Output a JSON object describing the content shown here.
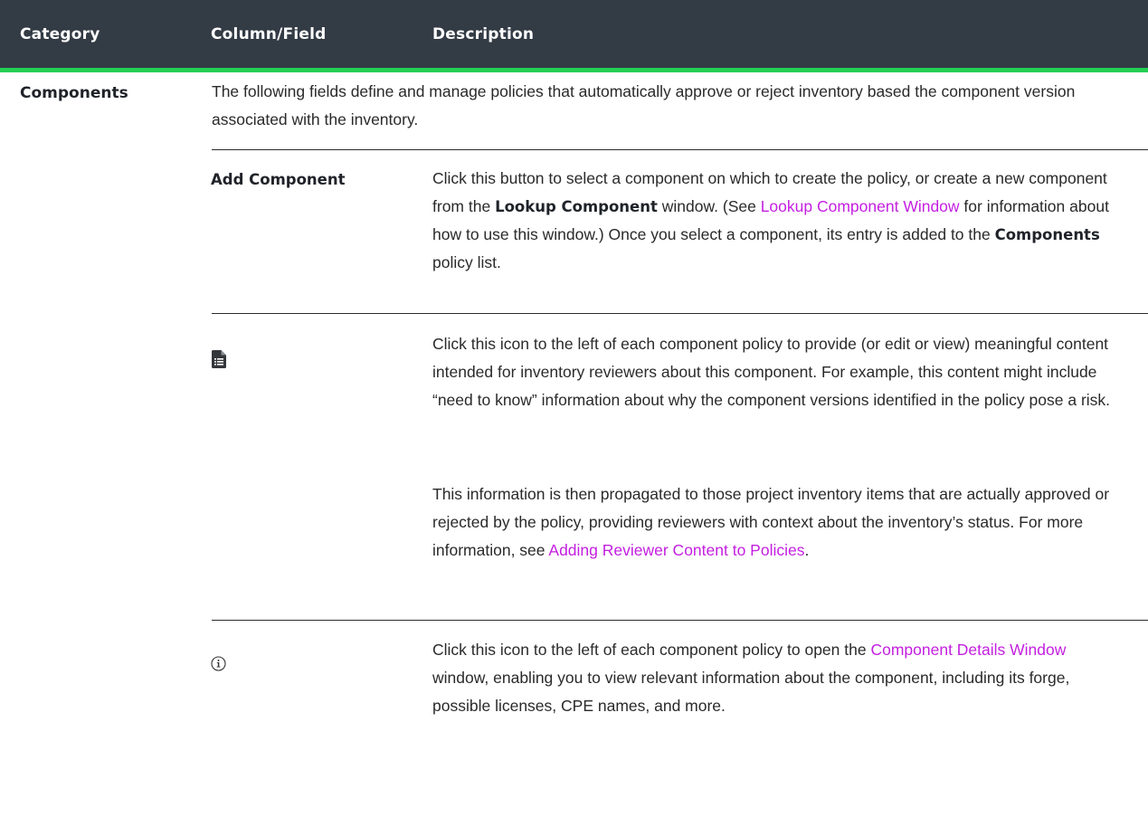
{
  "table": {
    "headers": [
      "Category",
      "Column/Field",
      "Description"
    ],
    "category": "Components",
    "intro": "The following fields define and manage policies that automatically approve or reject inventory based the component version associated with the inventory.",
    "rows": [
      {
        "field": "Add Component",
        "desc": {
          "t1": "Click this button to select a component on which to create the policy, or create a new component from the ",
          "b1": "Lookup Component",
          "t2": " window. (See ",
          "link": "Lookup Component Window",
          "t3": " for information about how to use this window.) Once you select a component, its entry is added to the ",
          "b2": "Components",
          "t4": " policy list."
        }
      },
      {
        "icon": "document-list-icon",
        "desc1": "Click this icon to the left of each component policy to provide (or edit or view) meaningful content intended for inventory reviewers about this component. For example, this content might include “need to know” information about why the component versions identified in the policy pose a risk.",
        "desc2_text": "This information is then propagated to those project inventory items that are actually approved or rejected by the policy, providing reviewers with context about the inventory’s status. For more information, see ",
        "desc2_link": "Adding Reviewer Content to Policies",
        "desc2_end": "."
      },
      {
        "icon": "info-circle-icon",
        "desc_t1": "Click this icon to the left of each component policy to open the ",
        "desc_link": "Component Details Window",
        "desc_t2": " window, enabling you to view relevant information about the component, including its forge, possible licenses, CPE names, and more."
      }
    ]
  },
  "colors": {
    "header_bg": "#333b45",
    "header_accent": "#25cf55",
    "link": "#c41fe0"
  }
}
